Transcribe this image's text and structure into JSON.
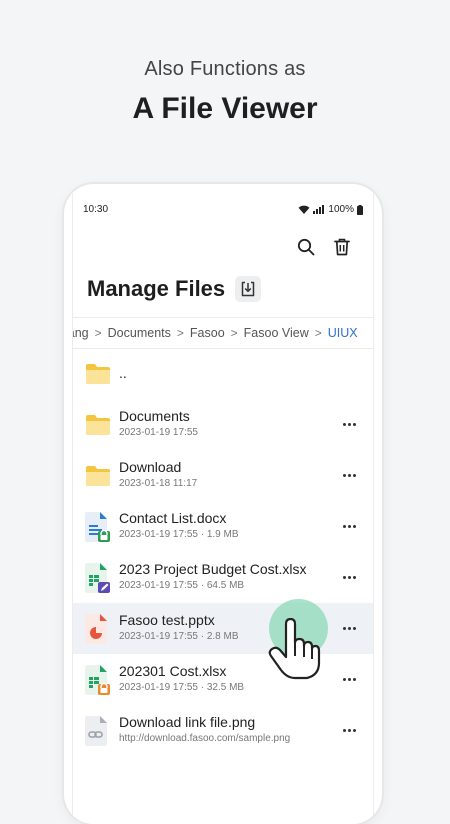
{
  "promo": {
    "subtitle": "Also Functions as",
    "title": "A File Viewer"
  },
  "status_bar": {
    "time": "10:30",
    "battery": "100%"
  },
  "toolbar": {
    "search_icon": "search-icon",
    "delete_icon": "trash-icon"
  },
  "header": {
    "title": "Manage Files",
    "download_icon": "download-icon"
  },
  "breadcrumb": {
    "items": [
      "lang",
      "Documents",
      "Fasoo",
      "Fasoo View",
      "UIUX"
    ],
    "separator": ">"
  },
  "files": [
    {
      "name": "..",
      "meta": "",
      "type": "folder"
    },
    {
      "name": "Documents",
      "meta": "2023-01-19  17:55",
      "type": "folder"
    },
    {
      "name": "Download",
      "meta": "2023-01-18  11:17",
      "type": "folder"
    },
    {
      "name": "Contact List.docx",
      "meta": "2023-01-19  17:55 · 1.9 MB",
      "type": "docx-locked"
    },
    {
      "name": "2023 Project Budget Cost.xlsx",
      "meta": "2023-01-19  17:55 · 64.5 MB",
      "type": "xlsx-edit"
    },
    {
      "name": "Fasoo test.pptx",
      "meta": "2023-01-19  17:55 · 2.8 MB",
      "type": "pptx",
      "selected": true
    },
    {
      "name": "202301 Cost.xlsx",
      "meta": "2023-01-19  17:55 · 32.5 MB",
      "type": "xlsx-locked"
    },
    {
      "name": "Download link file.png",
      "meta": "http://download.fasoo.com/sample.png",
      "type": "link"
    }
  ],
  "colors": {
    "folder": "#fbd04b",
    "docx": "#2b7cd3",
    "xlsx": "#21a366",
    "pptx": "#e8553f",
    "accent": "#2f6fcf",
    "touch": "#8cd8b8"
  }
}
